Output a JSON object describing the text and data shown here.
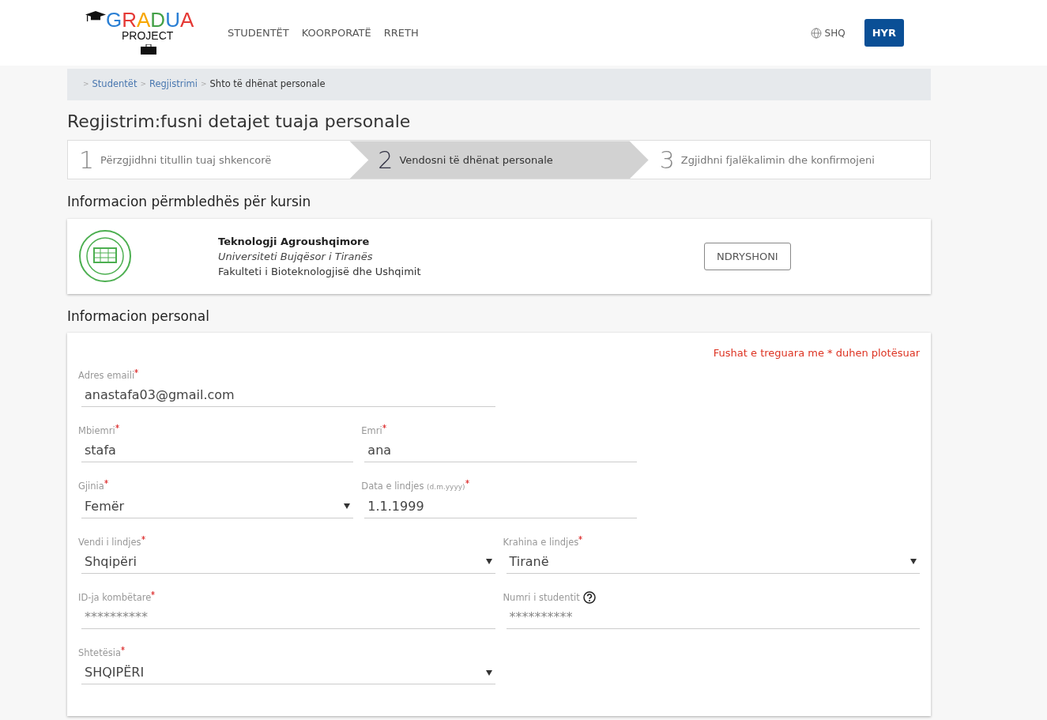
{
  "navbar": {
    "logo": {
      "title": "GRADUA",
      "subtitle": "PROJECT"
    },
    "links": [
      {
        "label": "STUDENTËT"
      },
      {
        "label": "KOORPORATË"
      },
      {
        "label": "RRETH"
      }
    ],
    "language": "SHQ",
    "login_button": "HYR"
  },
  "breadcrumb": [
    {
      "separator": ">",
      "label": "Studentët",
      "current": false
    },
    {
      "separator": ">",
      "label": "Regjistrimi",
      "current": false
    },
    {
      "separator": ">",
      "label": "Shto të dhënat personale",
      "current": true
    }
  ],
  "page_title": "Regjistrim:fusni detajet tuaja personale",
  "steps": [
    {
      "number": "1",
      "label": "Përzgjidhni titullin tuaj shkencorë",
      "selected": false
    },
    {
      "number": "2",
      "label": "Vendosni të dhënat personale",
      "selected": true
    },
    {
      "number": "3",
      "label": "Zgjidhni fjalëkalimin dhe konfirmojeni",
      "selected": false
    }
  ],
  "course_section": {
    "title": "Informacion përmbledhës për kursin",
    "course": "Teknologji Agroushqimore",
    "university": "Universiteti Bujqësor i Tiranës",
    "faculty": "Fakulteti i Bioteknologjisë dhe Ushqimit",
    "button": "NDRYSHONI"
  },
  "personal_section": {
    "title": "Informacion personal",
    "required_note": "Fushat e treguara me * duhen plotësuar",
    "rows": [
      [
        {
          "kind": "text",
          "label": "Adres emaili",
          "required": true,
          "value": "anastafa03@gmail.com"
        }
      ],
      [
        {
          "kind": "text",
          "label": "Mbiemri",
          "required": true,
          "value": "stafa"
        },
        {
          "kind": "text",
          "label": "Emri",
          "required": true,
          "value": "ana"
        }
      ],
      [
        {
          "kind": "select",
          "label": "Gjinia",
          "required": true,
          "value": "Femër"
        },
        {
          "kind": "text",
          "label": "Data e lindjes",
          "hint": "(d.m.yyyy)",
          "required": true,
          "value": "1.1.1999"
        }
      ],
      [
        {
          "kind": "select",
          "label": "Vendi i lindjes",
          "required": true,
          "value": "Shqipëri"
        },
        {
          "kind": "select",
          "label": "Krahina e lindjes",
          "required": true,
          "value": "Tiranë"
        }
      ],
      [
        {
          "kind": "text",
          "label": "ID-ja kombëtare",
          "required": true,
          "placeholder": "**********"
        },
        {
          "kind": "text",
          "label": "Numri i studentit",
          "required": false,
          "help": true,
          "placeholder": "**********"
        }
      ],
      [
        {
          "kind": "select",
          "label": "Shtetësia",
          "required": true,
          "value": "SHQIPËRI"
        }
      ]
    ]
  }
}
